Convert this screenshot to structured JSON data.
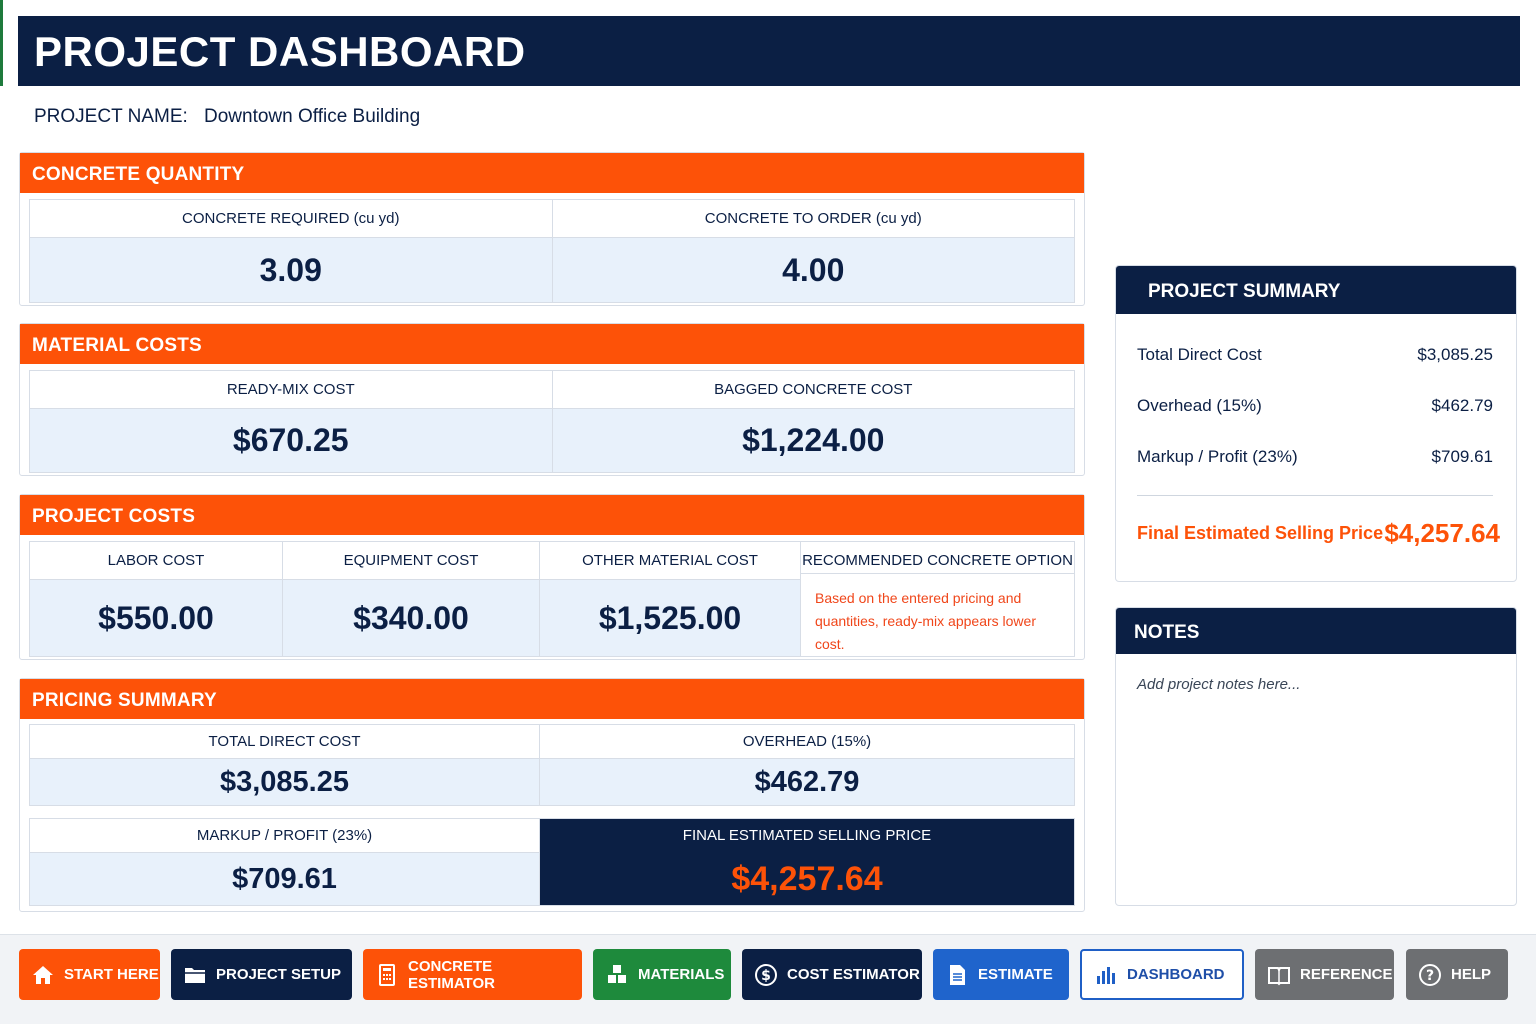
{
  "header": {
    "title": "PROJECT DASHBOARD"
  },
  "project": {
    "name_label": "PROJECT NAME:",
    "name_value": "Downtown Office Building"
  },
  "concrete_quantity": {
    "title": "CONCRETE QUANTITY",
    "required_label": "CONCRETE REQUIRED (cu yd)",
    "required_value": "3.09",
    "order_label": "CONCRETE TO ORDER (cu yd)",
    "order_value": "4.00"
  },
  "material_costs": {
    "title": "MATERIAL COSTS",
    "readymix_label": "READY-MIX COST",
    "readymix_value": "$670.25",
    "bagged_label": "BAGGED CONCRETE COST",
    "bagged_value": "$1,224.00"
  },
  "project_costs": {
    "title": "PROJECT COSTS",
    "labor_label": "LABOR COST",
    "labor_value": "$550.00",
    "equipment_label": "EQUIPMENT COST",
    "equipment_value": "$340.00",
    "other_label": "OTHER MATERIAL COST",
    "other_value": "$1,525.00",
    "recommend_label": "RECOMMENDED CONCRETE OPTION",
    "recommend_note": "Based on the entered pricing and quantities, ready-mix appears lower cost."
  },
  "pricing_summary": {
    "title": "PRICING SUMMARY",
    "direct_label": "TOTAL DIRECT COST",
    "direct_value": "$3,085.25",
    "overhead_label": "OVERHEAD (15%)",
    "overhead_value": "$462.79",
    "markup_label": "MARKUP / PROFIT (23%)",
    "markup_value": "$709.61",
    "final_label": "FINAL ESTIMATED SELLING PRICE",
    "final_value": "$4,257.64"
  },
  "summary_panel": {
    "title": "PROJECT SUMMARY",
    "rows": [
      {
        "label": "Total Direct Cost",
        "value": "$3,085.25"
      },
      {
        "label": "Overhead (15%)",
        "value": "$462.79"
      },
      {
        "label": "Markup / Profit (23%)",
        "value": "$709.61"
      }
    ],
    "final_label": "Final Estimated Selling Price",
    "final_value": "$4,257.64"
  },
  "notes": {
    "title": "NOTES",
    "placeholder": "Add project notes here..."
  },
  "nav": [
    {
      "label": "START HERE",
      "icon": "home-icon",
      "color": "#fd5208"
    },
    {
      "label": "PROJECT SETUP",
      "icon": "folder-icon",
      "color": "#0b1f44"
    },
    {
      "label": "CONCRETE ESTIMATOR",
      "icon": "calculator-icon",
      "color": "#fd5208"
    },
    {
      "label": "MATERIALS",
      "icon": "boxes-icon",
      "color": "#1e8a3c"
    },
    {
      "label": "COST ESTIMATOR",
      "icon": "dollar-icon",
      "color": "#0b1f44"
    },
    {
      "label": "ESTIMATE",
      "icon": "document-icon",
      "color": "#1f64cc"
    },
    {
      "label": "DASHBOARD",
      "icon": "bar-chart-icon",
      "color": "#ffffff",
      "active": true
    },
    {
      "label": "REFERENCE",
      "icon": "book-icon",
      "color": "#6d6f72"
    },
    {
      "label": "HELP",
      "icon": "help-icon",
      "color": "#6d6f72"
    }
  ]
}
